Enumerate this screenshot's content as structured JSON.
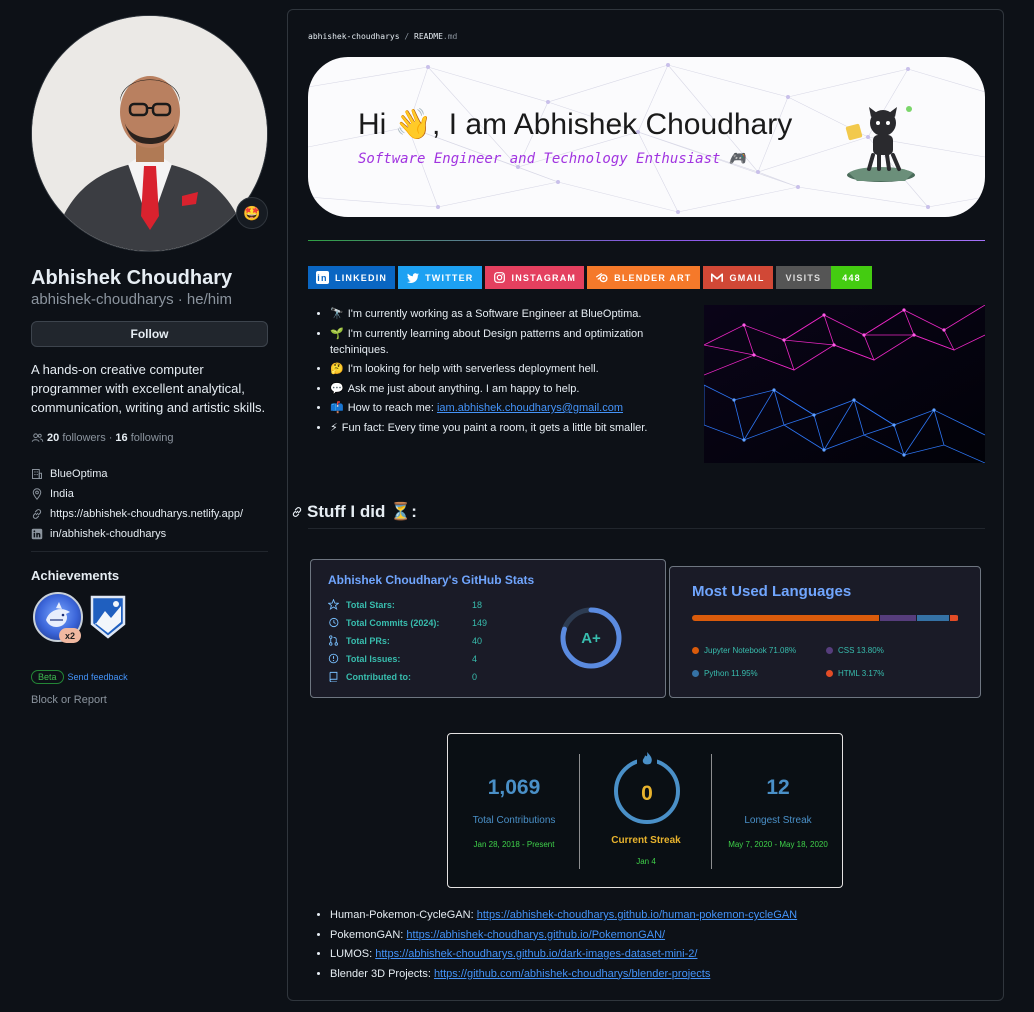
{
  "profile": {
    "name": "Abhishek Choudhary",
    "login_line": "abhishek-choudharys · he/him",
    "status_emoji": "🤩",
    "follow_label": "Follow",
    "bio": "A hands-on creative computer programmer with excellent analytical, communication, writing and artistic skills.",
    "followers_count": "20",
    "followers_label": "followers",
    "separator": "·",
    "following_count": "16",
    "following_label": "following",
    "company": "BlueOptima",
    "location": "India",
    "website": "https://abhishek-choudharys.netlify.app/",
    "linkedin": "in/abhishek-choudharys"
  },
  "achievements": {
    "title": "Achievements",
    "badge_count": "x2",
    "beta_label": "Beta",
    "feedback_label": "Send feedback",
    "block_label": "Block or Report"
  },
  "readme": {
    "path_user": "abhishek-choudharys",
    "path_sep": "/",
    "path_file": "README",
    "path_ext": ".md",
    "banner_title": "Hi 👋, I am Abhishek Choudhary",
    "banner_subtitle": "Software Engineer and Technology Enthusiast 🎮",
    "badges": [
      {
        "label": "LINKEDIN",
        "color": "#0a66c2",
        "icon": "linkedin-icon"
      },
      {
        "label": "TWITTER",
        "color": "#1da1f2",
        "icon": "twitter-icon"
      },
      {
        "label": "INSTAGRAM",
        "color": "#e4405f",
        "icon": "instagram-icon"
      },
      {
        "label": "BLENDER ART",
        "color": "#f5792a",
        "icon": "blender-icon"
      },
      {
        "label": "GMAIL",
        "color": "#d14836",
        "icon": "gmail-icon"
      }
    ],
    "visits_label": "VISITS",
    "visits_count": "448",
    "about": [
      {
        "emoji": "🔭",
        "text": "I'm currently working as a Software Engineer at BlueOptima."
      },
      {
        "emoji": "🌱",
        "text": "I'm currently learning about Design patterns and optimization techiniques."
      },
      {
        "emoji": "🤔",
        "text": "I'm looking for help with serverless deployment hell."
      },
      {
        "emoji": "💬",
        "text": "Ask me just about anything. I am happy to help."
      },
      {
        "emoji": "📫",
        "text": "How to reach me: ",
        "link": "iam.abhishek.choudharys@gmail.com"
      },
      {
        "emoji": "⚡",
        "text": "Fun fact: Every time you paint a room, it gets a little bit smaller."
      }
    ],
    "stuff_heading": "Stuff I did ⏳:"
  },
  "stats_card": {
    "title": "Abhishek Choudhary's GitHub Stats",
    "rows": [
      {
        "label": "Total Stars:",
        "value": "18",
        "icon": "star-icon"
      },
      {
        "label": "Total Commits (2024):",
        "value": "149",
        "icon": "history-icon"
      },
      {
        "label": "Total PRs:",
        "value": "40",
        "icon": "pull-request-icon"
      },
      {
        "label": "Total Issues:",
        "value": "4",
        "icon": "issue-icon"
      },
      {
        "label": "Contributed to:",
        "value": "0",
        "icon": "repo-icon"
      }
    ],
    "grade": "A+",
    "grade_fraction": 0.8
  },
  "languages_card": {
    "title": "Most Used Languages",
    "languages": [
      {
        "name": "Jupyter Notebook",
        "percent": 71.08,
        "label": "Jupyter Notebook 71.08%",
        "color": "#da5b0b"
      },
      {
        "name": "CSS",
        "percent": 13.8,
        "label": "CSS 13.80%",
        "color": "#563d7c"
      },
      {
        "name": "Python",
        "percent": 11.95,
        "label": "Python 11.95%",
        "color": "#3572a5"
      },
      {
        "name": "HTML",
        "percent": 3.17,
        "label": "HTML 3.17%",
        "color": "#e34c26"
      }
    ]
  },
  "streak_card": {
    "total_value": "1,069",
    "total_label": "Total Contributions",
    "total_range": "Jan 28, 2018 - Present",
    "current_value": "0",
    "current_label": "Current Streak",
    "current_date": "Jan 4",
    "longest_value": "12",
    "longest_label": "Longest Streak",
    "longest_range": "May 7, 2020 - May 18, 2020"
  },
  "projects": [
    {
      "name": "Human-Pokemon-CycleGAN: ",
      "url": "https://abhishek-choudharys.github.io/human-pokemon-cycleGAN"
    },
    {
      "name": "PokemonGAN: ",
      "url": "https://abhishek-choudharys.github.io/PokemonGAN/"
    },
    {
      "name": "LUMOS: ",
      "url": "https://abhishek-choudharys.github.io/dark-images-dataset-mini-2/"
    },
    {
      "name": "Blender 3D Projects: ",
      "url": "https://github.com/abhishek-choudharys/blender-projects"
    }
  ]
}
